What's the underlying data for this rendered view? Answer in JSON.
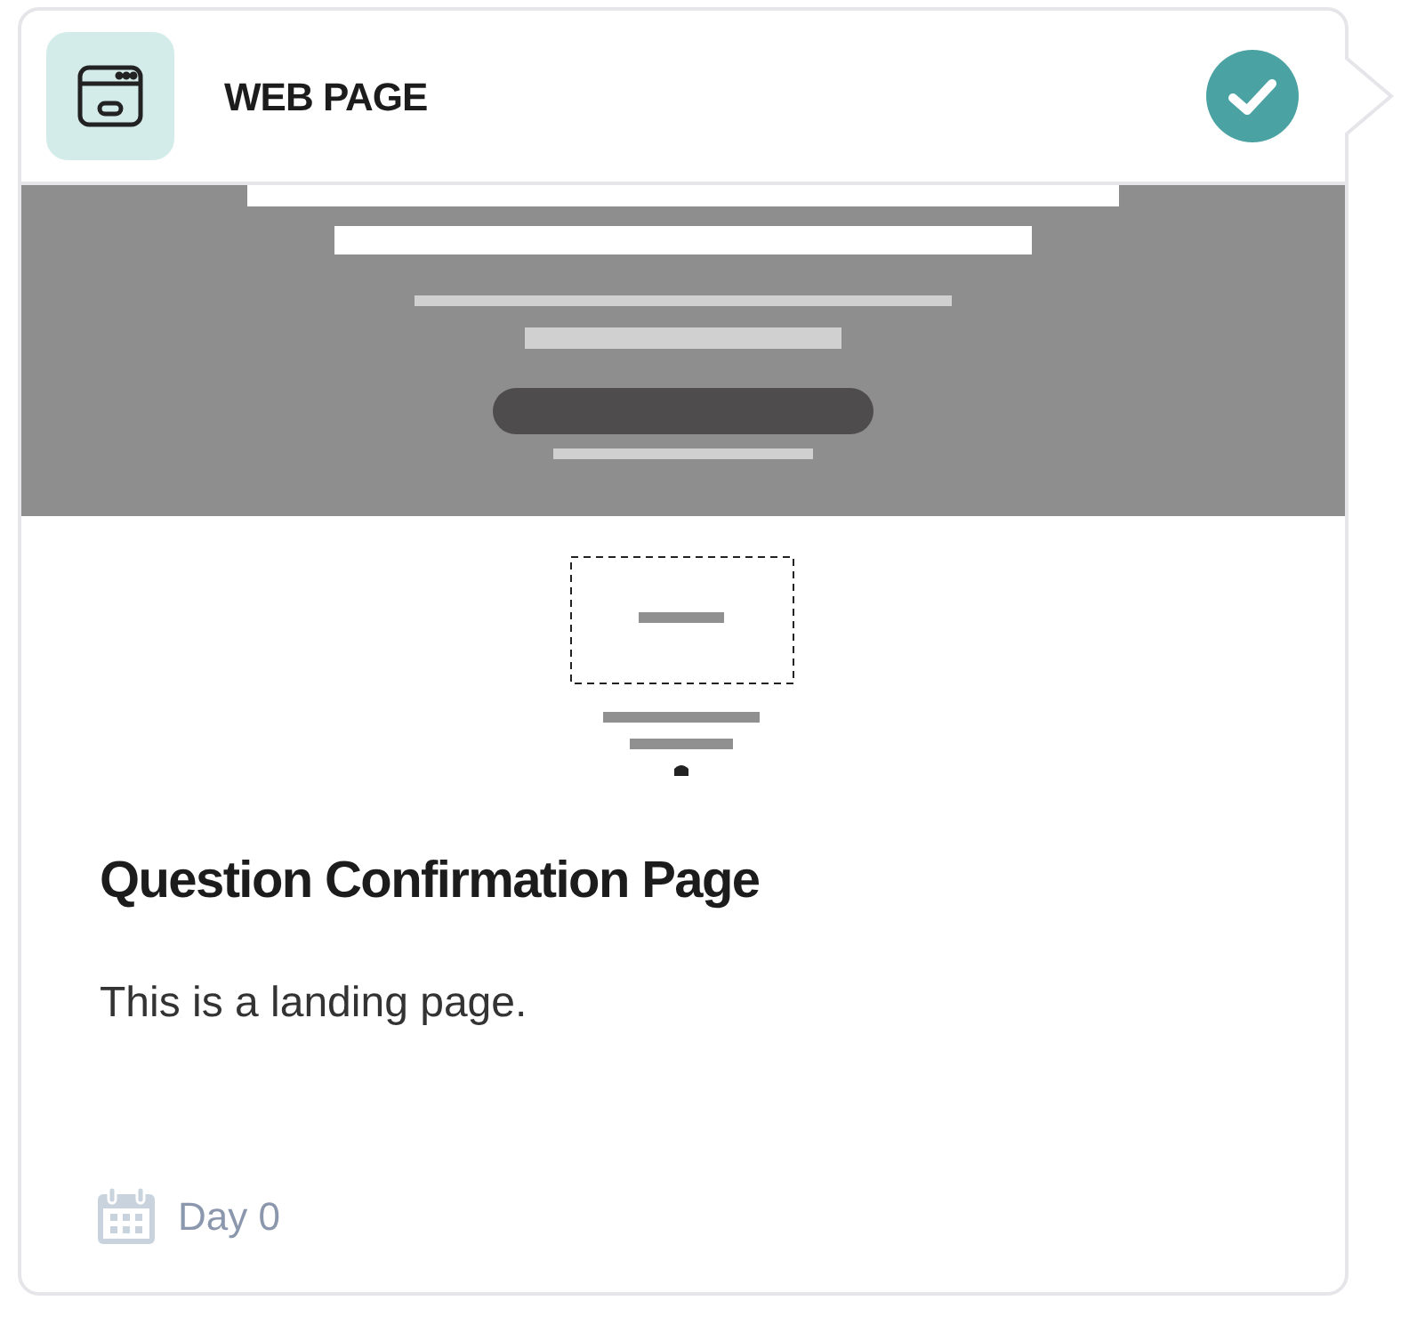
{
  "header": {
    "title": "WEB PAGE",
    "completed": true
  },
  "card": {
    "title": "Question Confirmation Page",
    "description": "This is a landing page."
  },
  "footer": {
    "day": "Day 0"
  }
}
